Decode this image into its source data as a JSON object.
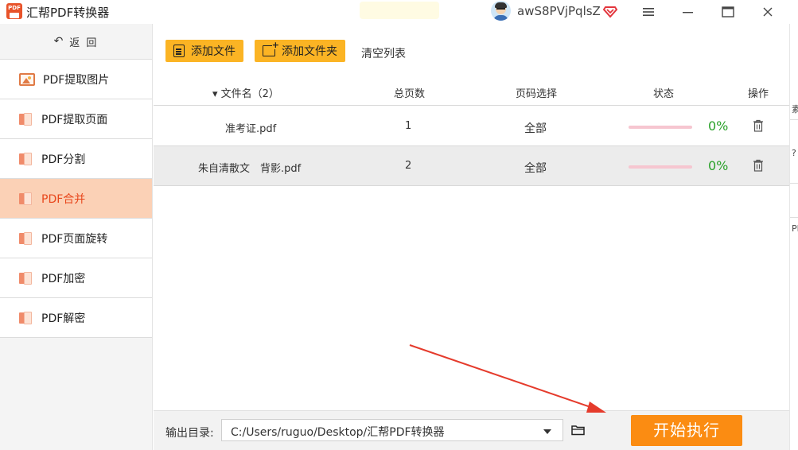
{
  "titlebar": {
    "app_title": "汇帮PDF转换器",
    "logo_text": "PDF",
    "username": "awS8PVjPqlsZ",
    "menu_icon": "hamburger-icon",
    "minimize_icon": "minimize-icon",
    "maximize_icon": "maximize-icon",
    "close_icon": "close-icon"
  },
  "sidebar": {
    "back_label": "返 回",
    "items": [
      {
        "label": "PDF提取图片",
        "icon": "image-icon"
      },
      {
        "label": "PDF提取页面",
        "icon": "pdf-icon"
      },
      {
        "label": "PDF分割",
        "icon": "pdf-icon"
      },
      {
        "label": "PDF合并",
        "icon": "pdf-icon",
        "active": true
      },
      {
        "label": "PDF页面旋转",
        "icon": "pdf-icon"
      },
      {
        "label": "PDF加密",
        "icon": "pdf-icon"
      },
      {
        "label": "PDF解密",
        "icon": "pdf-icon"
      }
    ]
  },
  "toolbar": {
    "add_file": "添加文件",
    "add_folder": "添加文件夹",
    "clear_list": "清空列表"
  },
  "table": {
    "headers": {
      "filename": "▾ 文件名（2）",
      "pages": "总页数",
      "page_select": "页码选择",
      "status": "状态",
      "action": "操作"
    },
    "rows": [
      {
        "filename": "准考证.pdf",
        "pages": "1",
        "page_select": "全部",
        "progress": "0%"
      },
      {
        "filename": "朱自清散文　背影.pdf",
        "pages": "2",
        "page_select": "全部",
        "progress": "0%"
      }
    ]
  },
  "bottom": {
    "output_label": "输出目录:",
    "output_path": "C:/Users/ruguo/Desktop/汇帮PDF转换器",
    "start_button": "开始执行"
  },
  "right_edge": {
    "text1": "素",
    "text2": "?",
    "text3": "PI"
  },
  "colors": {
    "accent": "#fbb424",
    "start": "#fb8c12",
    "active_nav": "#fbd1b6",
    "active_text": "#e8471c",
    "progress": "#2aa12a",
    "annotation": "#e53b2c"
  }
}
